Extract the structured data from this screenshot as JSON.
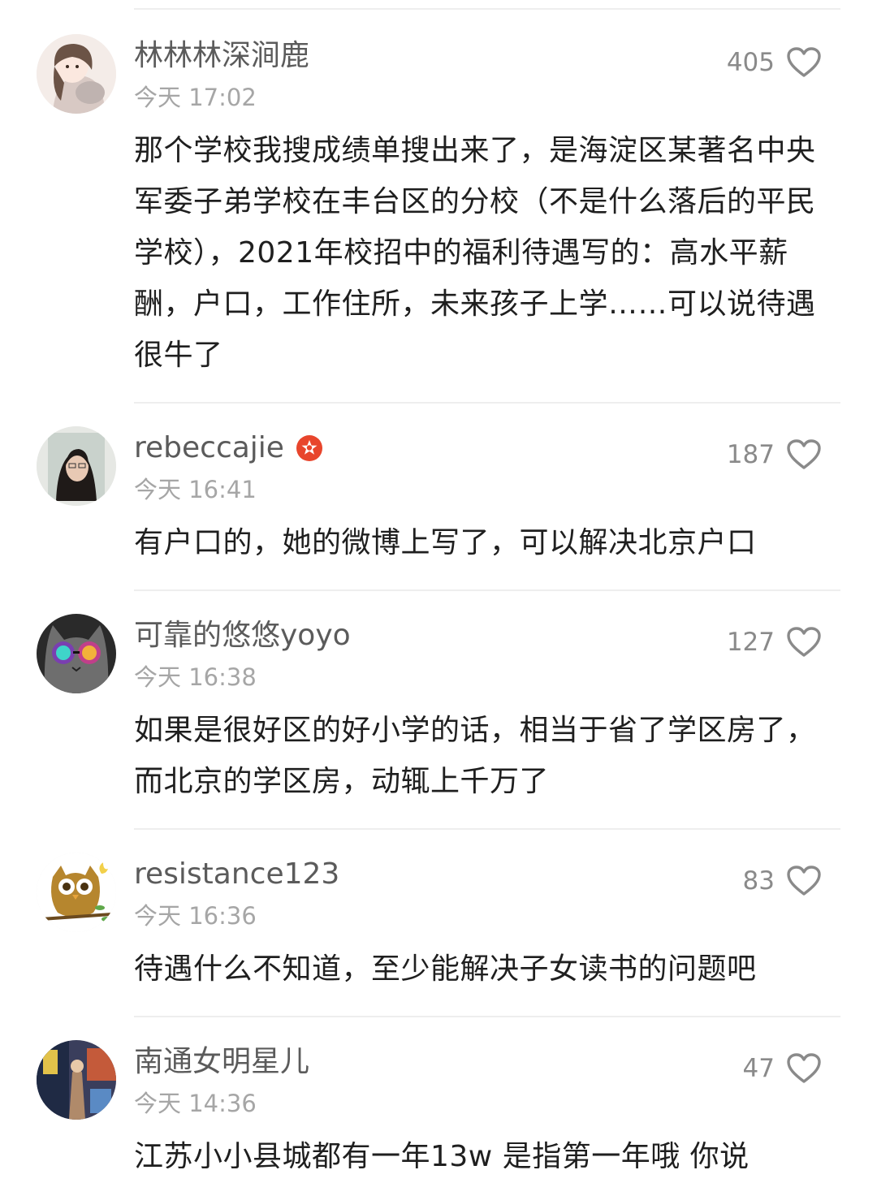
{
  "comments": [
    {
      "username": "林林林深涧鹿",
      "time": "今天 17:02",
      "likes": "405",
      "content": "那个学校我搜成绩单搜出来了，是海淀区某著名中央军委子弟学校在丰台区的分校（不是什么落后的平民学校），2021年校招中的福利待遇写的：高水平薪酬，户口，工作住所，未来孩子上学……可以说待遇很牛了"
    },
    {
      "username": "rebeccajie",
      "verified": true,
      "time": "今天 16:41",
      "likes": "187",
      "content": "有户口的，她的微博上写了，可以解决北京户口"
    },
    {
      "username": "可靠的悠悠yoyo",
      "time": "今天 16:38",
      "likes": "127",
      "content": "如果是很好区的好小学的话，相当于省了学区房了，而北京的学区房，动辄上千万了"
    },
    {
      "username": "resistance123",
      "time": "今天 16:36",
      "likes": "83",
      "content": "待遇什么不知道，至少能解决子女读书的问题吧"
    },
    {
      "username": "南通女明星儿",
      "time": "今天 14:36",
      "likes": "47",
      "content": "江苏小小县城都有一年13w 是指第一年哦 你说"
    }
  ],
  "icons": {
    "like": "heart-outline-icon",
    "verified": "verified-badge-icon"
  },
  "colors": {
    "verified_badge": "#e8452c",
    "username": "#5b5b5b",
    "timestamp": "#a6a6a6",
    "content": "#1f1f1f"
  }
}
